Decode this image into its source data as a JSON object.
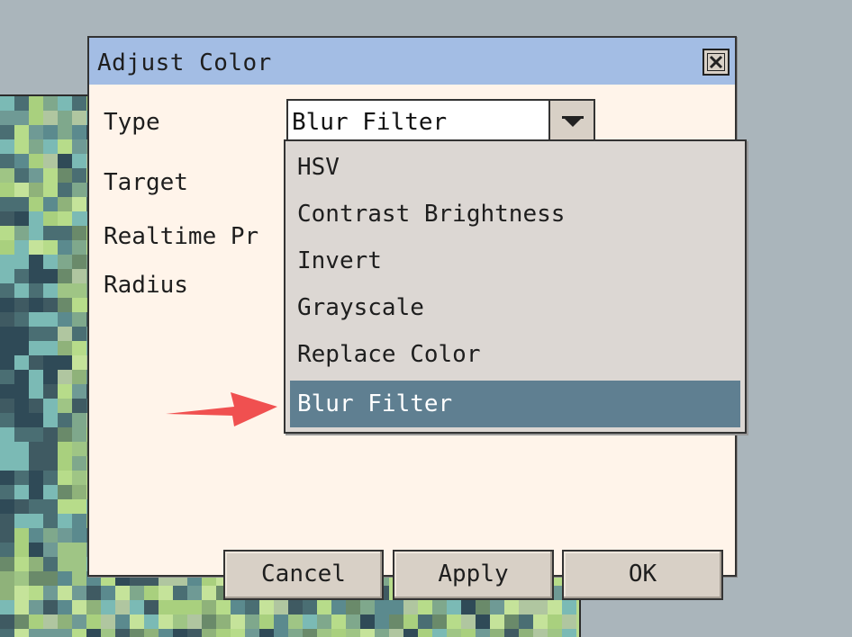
{
  "dialog": {
    "title": "Adjust Color",
    "labels": {
      "type": "Type",
      "target": "Target",
      "realtime": "Realtime Pr",
      "radius": "Radius"
    },
    "type_select": {
      "value": "Blur Filter",
      "options": [
        "HSV",
        "Contrast Brightness",
        "Invert",
        "Grayscale",
        "Replace Color",
        "Blur Filter"
      ],
      "selected_index": 5
    },
    "buttons": {
      "cancel": "Cancel",
      "apply": "Apply",
      "ok": "OK"
    }
  },
  "colors": {
    "titlebar": "#a3bde4",
    "dialog_bg": "#fff4ea",
    "dropdown_bg": "#dcd7d3",
    "selected": "#5f7f91",
    "annotation_arrow": "#f05050"
  }
}
